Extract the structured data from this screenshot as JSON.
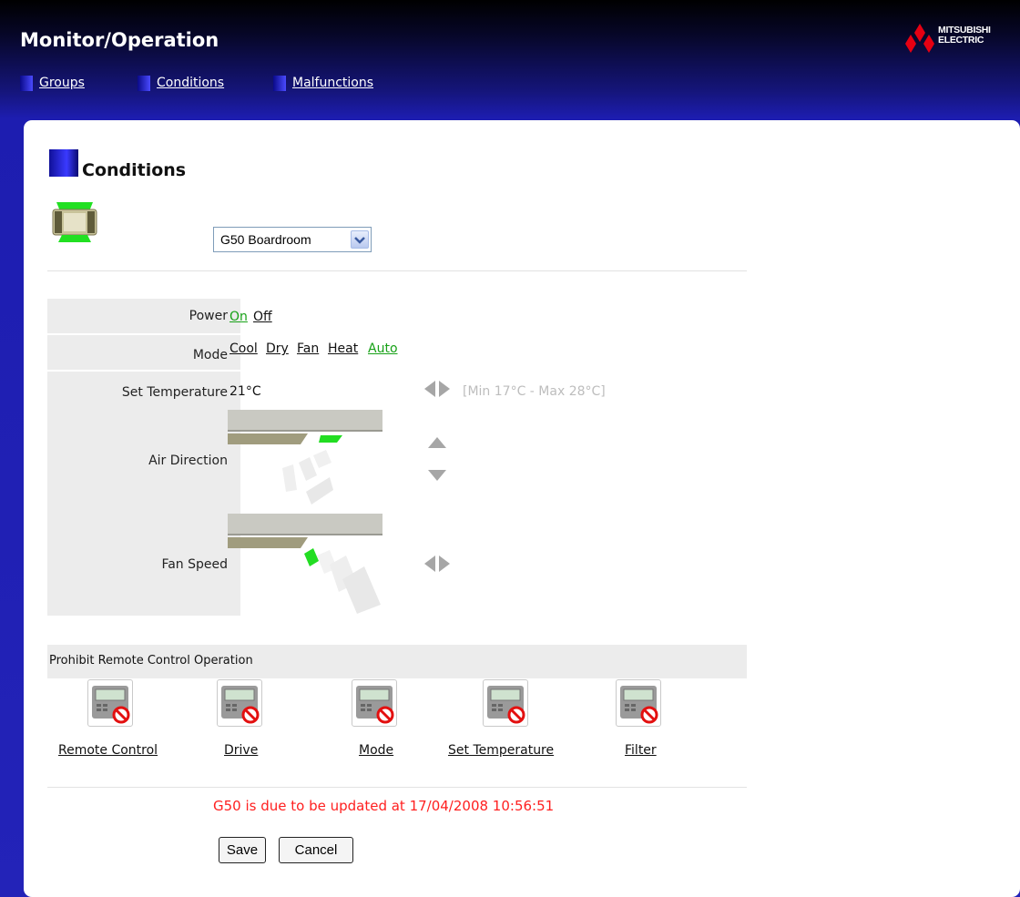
{
  "header": {
    "title": "Monitor/Operation",
    "logo_text_line1": "MITSUBISHI",
    "logo_text_line2": "ELECTRIC",
    "brand_color": "#e60012"
  },
  "nav": {
    "items": [
      {
        "label": "Groups"
      },
      {
        "label": "Conditions"
      },
      {
        "label": "Malfunctions"
      }
    ]
  },
  "section": {
    "title": "Conditions"
  },
  "group_select": {
    "selected": "G50 Boardroom"
  },
  "conditions": {
    "power": {
      "label": "Power",
      "options": [
        "On",
        "Off"
      ],
      "active": "On"
    },
    "mode": {
      "label": "Mode",
      "options": [
        "Cool",
        "Dry",
        "Fan",
        "Heat",
        "Auto"
      ],
      "active": "Auto"
    },
    "set_temperature": {
      "label": "Set Temperature",
      "value": "21°C",
      "range": "[Min 17°C - Max 28°C]"
    },
    "air_direction": {
      "label": "Air Direction"
    },
    "fan_speed": {
      "label": "Fan Speed"
    }
  },
  "prohibit": {
    "title": "Prohibit Remote Control Operation",
    "items": [
      {
        "label": "Remote Control"
      },
      {
        "label": "Drive"
      },
      {
        "label": "Mode"
      },
      {
        "label": "Set Temperature"
      },
      {
        "label": "Filter"
      }
    ]
  },
  "status": {
    "update_message": "G50 is due to be updated at 17/04/2008 10:56:51"
  },
  "buttons": {
    "save": "Save",
    "cancel": "Cancel"
  },
  "colors": {
    "active_option": "#17a117",
    "warning_text": "#ff2020",
    "range_text": "#bdbdbd"
  }
}
